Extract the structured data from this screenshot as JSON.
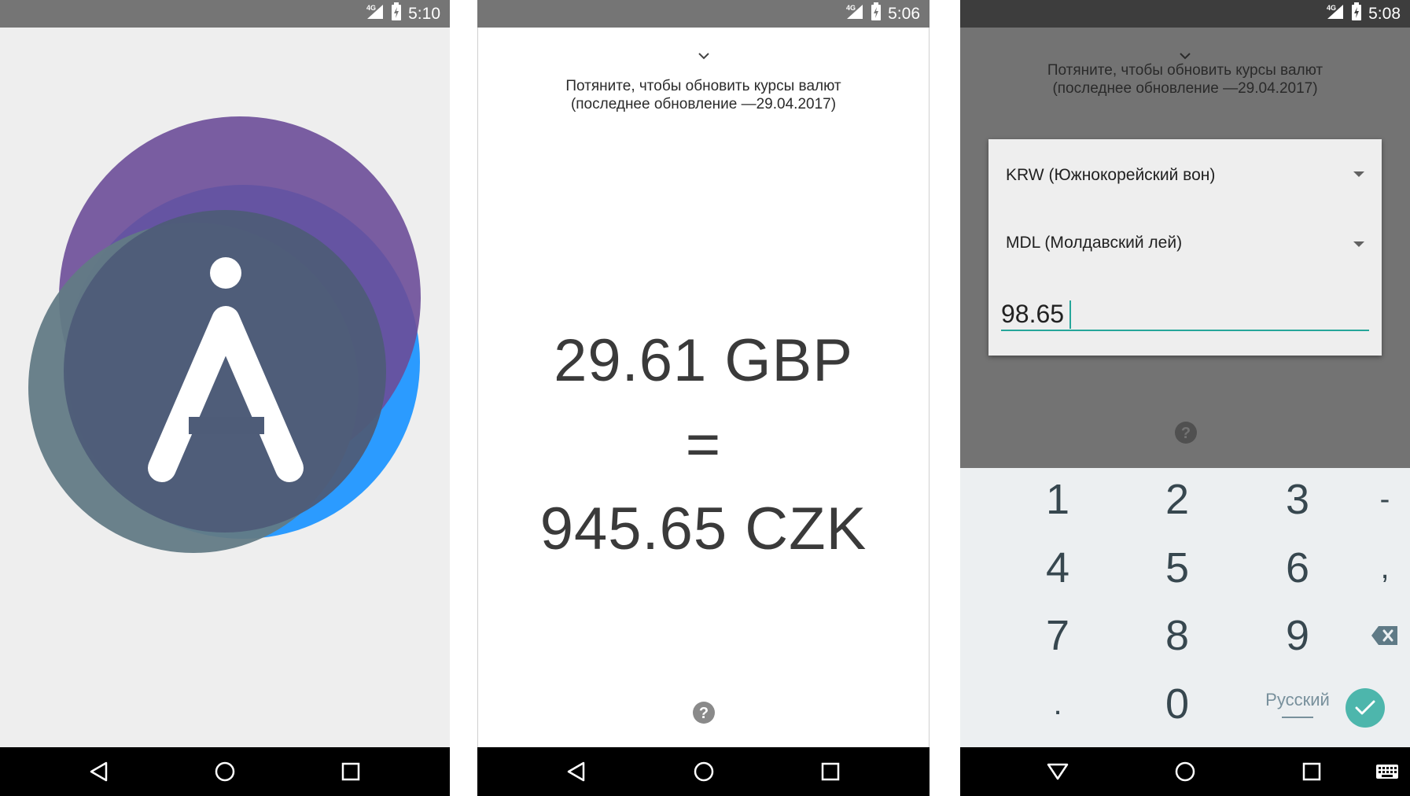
{
  "screens": [
    {
      "status": {
        "time": "5:10",
        "network": "4G"
      },
      "splash": {
        "logo_letter": "A",
        "colors": {
          "blue": "#2b9bff",
          "purple": "#6a4b9a",
          "slate": "#4e5c78",
          "gray": "#627a85"
        }
      },
      "nav": [
        "back-icon",
        "home-icon",
        "recents-icon"
      ]
    },
    {
      "status": {
        "time": "5:06",
        "network": "4G"
      },
      "pull_hint": {
        "line1": "Потяните, чтобы обновить курсы валют",
        "line2": "(последнее обновление —29.04.2017)"
      },
      "conversion": {
        "from": "29.61 GBP",
        "equals": "=",
        "to": "945.65 CZK"
      },
      "nav": [
        "back-icon",
        "home-icon",
        "recents-icon"
      ]
    },
    {
      "status": {
        "time": "5:08",
        "network": "4G"
      },
      "pull_hint": {
        "line1": "Потяните, чтобы обновить курсы валют",
        "line2": "(последнее обновление —29.04.2017)"
      },
      "dialog": {
        "from_currency": "KRW (Южнокорейский вон)",
        "to_currency": "MDL (Молдавский лей)",
        "amount": "98.65"
      },
      "keyboard": {
        "keys": [
          "1",
          "2",
          "3",
          "-",
          "4",
          "5",
          "6",
          ",",
          "7",
          "8",
          "9",
          ".",
          "0"
        ],
        "language": "Русский",
        "accent": "#4db6ac"
      },
      "nav": [
        "hide-keyboard-icon",
        "home-icon",
        "recents-icon",
        "keyboard-icon"
      ]
    }
  ]
}
